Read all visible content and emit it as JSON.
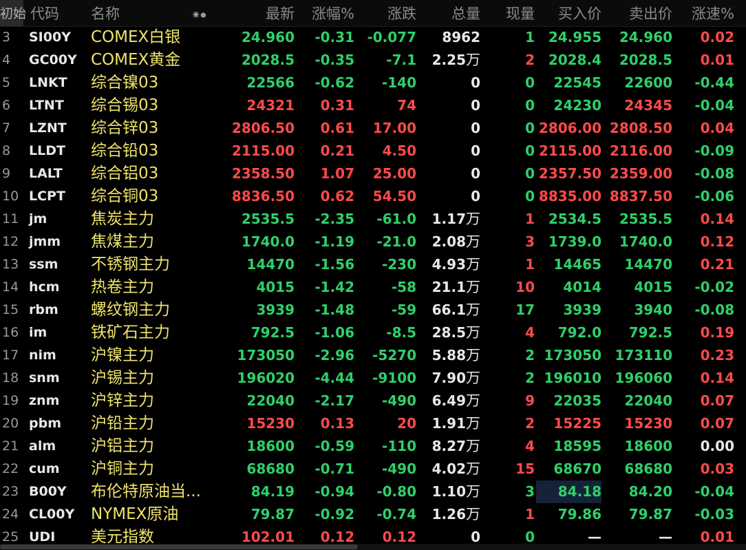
{
  "header": {
    "init": "初始",
    "code": "代码",
    "name": "名称",
    "icons": "✷⏺",
    "last": "最新",
    "pct": "涨幅%",
    "chg": "涨跌",
    "vol": "总量",
    "cur": "现量",
    "bid": "买入价",
    "ask": "卖出价",
    "spd": "涨速%"
  },
  "colors": {
    "up": "#ff4a4a",
    "down": "#2fd06a",
    "flat": "#e8e8e8",
    "name": "#f0e36a",
    "background": "#000000"
  },
  "rows": [
    {
      "idx": "3",
      "code": "SI00Y",
      "name": "COMEX白银",
      "last": "24.960",
      "pct": "-0.31",
      "chg": "-0.077",
      "vol": "8962",
      "vol_unit": "",
      "cur": "1",
      "bid": "24.955",
      "ask": "24.960",
      "spd": "0.02",
      "dir": "dn",
      "cur_dir": "dn",
      "spd_dir": "up",
      "bid_dir": "dn",
      "ask_dir": "dn"
    },
    {
      "idx": "4",
      "code": "GC00Y",
      "name": "COMEX黄金",
      "last": "2028.5",
      "pct": "-0.35",
      "chg": "-7.1",
      "vol": "2.25",
      "vol_unit": "万",
      "cur": "2",
      "bid": "2028.4",
      "ask": "2028.5",
      "spd": "0.01",
      "dir": "dn",
      "cur_dir": "up",
      "spd_dir": "up",
      "bid_dir": "dn",
      "ask_dir": "dn"
    },
    {
      "idx": "5",
      "code": "LNKT",
      "name": "综合镍03",
      "last": "22566",
      "pct": "-0.62",
      "chg": "-140",
      "vol": "0",
      "vol_unit": "",
      "cur": "0",
      "bid": "22545",
      "ask": "22600",
      "spd": "-0.44",
      "dir": "dn",
      "cur_dir": "dn",
      "spd_dir": "dn",
      "bid_dir": "dn",
      "ask_dir": "dn"
    },
    {
      "idx": "6",
      "code": "LTNT",
      "name": "综合锡03",
      "last": "24321",
      "pct": "0.31",
      "chg": "74",
      "vol": "0",
      "vol_unit": "",
      "cur": "0",
      "bid": "24230",
      "ask": "24345",
      "spd": "-0.04",
      "dir": "up",
      "cur_dir": "dn",
      "spd_dir": "dn",
      "bid_dir": "dn",
      "ask_dir": "up"
    },
    {
      "idx": "7",
      "code": "LZNT",
      "name": "综合锌03",
      "last": "2806.50",
      "pct": "0.61",
      "chg": "17.00",
      "vol": "0",
      "vol_unit": "",
      "cur": "0",
      "bid": "2806.00",
      "ask": "2808.50",
      "spd": "0.04",
      "dir": "up",
      "cur_dir": "dn",
      "spd_dir": "up",
      "bid_dir": "up",
      "ask_dir": "up"
    },
    {
      "idx": "8",
      "code": "LLDT",
      "name": "综合铅03",
      "last": "2115.00",
      "pct": "0.21",
      "chg": "4.50",
      "vol": "0",
      "vol_unit": "",
      "cur": "0",
      "bid": "2115.00",
      "ask": "2116.00",
      "spd": "-0.09",
      "dir": "up",
      "cur_dir": "dn",
      "spd_dir": "dn",
      "bid_dir": "up",
      "ask_dir": "up"
    },
    {
      "idx": "9",
      "code": "LALT",
      "name": "综合铝03",
      "last": "2358.50",
      "pct": "1.07",
      "chg": "25.00",
      "vol": "0",
      "vol_unit": "",
      "cur": "0",
      "bid": "2357.50",
      "ask": "2359.00",
      "spd": "-0.08",
      "dir": "up",
      "cur_dir": "dn",
      "spd_dir": "dn",
      "bid_dir": "up",
      "ask_dir": "up"
    },
    {
      "idx": "10",
      "code": "LCPT",
      "name": "综合铜03",
      "last": "8836.50",
      "pct": "0.62",
      "chg": "54.50",
      "vol": "0",
      "vol_unit": "",
      "cur": "0",
      "bid": "8835.00",
      "ask": "8837.50",
      "spd": "-0.06",
      "dir": "up",
      "cur_dir": "dn",
      "spd_dir": "dn",
      "bid_dir": "up",
      "ask_dir": "up"
    },
    {
      "idx": "11",
      "code": "jm",
      "name": "焦炭主力",
      "last": "2535.5",
      "pct": "-2.35",
      "chg": "-61.0",
      "vol": "1.17",
      "vol_unit": "万",
      "cur": "1",
      "bid": "2534.5",
      "ask": "2535.5",
      "spd": "0.14",
      "dir": "dn",
      "cur_dir": "up",
      "spd_dir": "up",
      "bid_dir": "dn",
      "ask_dir": "dn"
    },
    {
      "idx": "12",
      "code": "jmm",
      "name": "焦煤主力",
      "last": "1740.0",
      "pct": "-1.19",
      "chg": "-21.0",
      "vol": "2.08",
      "vol_unit": "万",
      "cur": "3",
      "bid": "1739.0",
      "ask": "1740.0",
      "spd": "0.12",
      "dir": "dn",
      "cur_dir": "up",
      "spd_dir": "up",
      "bid_dir": "dn",
      "ask_dir": "dn"
    },
    {
      "idx": "13",
      "code": "ssm",
      "name": "不锈钢主力",
      "last": "14470",
      "pct": "-1.56",
      "chg": "-230",
      "vol": "4.93",
      "vol_unit": "万",
      "cur": "1",
      "bid": "14465",
      "ask": "14470",
      "spd": "0.21",
      "dir": "dn",
      "cur_dir": "up",
      "spd_dir": "up",
      "bid_dir": "dn",
      "ask_dir": "dn"
    },
    {
      "idx": "14",
      "code": "hcm",
      "name": "热卷主力",
      "last": "4015",
      "pct": "-1.42",
      "chg": "-58",
      "vol": "21.1",
      "vol_unit": "万",
      "cur": "10",
      "bid": "4014",
      "ask": "4015",
      "spd": "-0.02",
      "dir": "dn",
      "cur_dir": "up",
      "spd_dir": "dn",
      "bid_dir": "dn",
      "ask_dir": "dn"
    },
    {
      "idx": "15",
      "code": "rbm",
      "name": "螺纹钢主力",
      "last": "3939",
      "pct": "-1.48",
      "chg": "-59",
      "vol": "66.1",
      "vol_unit": "万",
      "cur": "17",
      "bid": "3939",
      "ask": "3940",
      "spd": "-0.08",
      "dir": "dn",
      "cur_dir": "dn",
      "spd_dir": "dn",
      "bid_dir": "dn",
      "ask_dir": "dn"
    },
    {
      "idx": "16",
      "code": "im",
      "name": "铁矿石主力",
      "last": "792.5",
      "pct": "-1.06",
      "chg": "-8.5",
      "vol": "28.5",
      "vol_unit": "万",
      "cur": "4",
      "bid": "792.0",
      "ask": "792.5",
      "spd": "0.19",
      "dir": "dn",
      "cur_dir": "up",
      "spd_dir": "up",
      "bid_dir": "dn",
      "ask_dir": "dn"
    },
    {
      "idx": "17",
      "code": "nim",
      "name": "沪镍主力",
      "last": "173050",
      "pct": "-2.96",
      "chg": "-5270",
      "vol": "5.88",
      "vol_unit": "万",
      "cur": "2",
      "bid": "173050",
      "ask": "173110",
      "spd": "0.23",
      "dir": "dn",
      "cur_dir": "dn",
      "spd_dir": "up",
      "bid_dir": "dn",
      "ask_dir": "dn"
    },
    {
      "idx": "18",
      "code": "snm",
      "name": "沪锡主力",
      "last": "196020",
      "pct": "-4.44",
      "chg": "-9100",
      "vol": "7.90",
      "vol_unit": "万",
      "cur": "2",
      "bid": "196010",
      "ask": "196060",
      "spd": "0.14",
      "dir": "dn",
      "cur_dir": "dn",
      "spd_dir": "up",
      "bid_dir": "dn",
      "ask_dir": "dn"
    },
    {
      "idx": "19",
      "code": "znm",
      "name": "沪锌主力",
      "last": "22040",
      "pct": "-2.17",
      "chg": "-490",
      "vol": "6.49",
      "vol_unit": "万",
      "cur": "9",
      "bid": "22035",
      "ask": "22040",
      "spd": "0.07",
      "dir": "dn",
      "cur_dir": "up",
      "spd_dir": "up",
      "bid_dir": "dn",
      "ask_dir": "dn"
    },
    {
      "idx": "20",
      "code": "pbm",
      "name": "沪铅主力",
      "last": "15230",
      "pct": "0.13",
      "chg": "20",
      "vol": "1.91",
      "vol_unit": "万",
      "cur": "2",
      "bid": "15225",
      "ask": "15230",
      "spd": "0.07",
      "dir": "up",
      "cur_dir": "up",
      "spd_dir": "up",
      "bid_dir": "up",
      "ask_dir": "up"
    },
    {
      "idx": "21",
      "code": "alm",
      "name": "沪铝主力",
      "last": "18600",
      "pct": "-0.59",
      "chg": "-110",
      "vol": "8.27",
      "vol_unit": "万",
      "cur": "4",
      "bid": "18595",
      "ask": "18600",
      "spd": "0.00",
      "dir": "dn",
      "cur_dir": "up",
      "spd_dir": "fl",
      "bid_dir": "dn",
      "ask_dir": "dn"
    },
    {
      "idx": "22",
      "code": "cum",
      "name": "沪铜主力",
      "last": "68680",
      "pct": "-0.71",
      "chg": "-490",
      "vol": "4.02",
      "vol_unit": "万",
      "cur": "15",
      "bid": "68670",
      "ask": "68680",
      "spd": "0.03",
      "dir": "dn",
      "cur_dir": "up",
      "spd_dir": "up",
      "bid_dir": "dn",
      "ask_dir": "dn"
    },
    {
      "idx": "23",
      "code": "B00Y",
      "name": "布伦特原油当...",
      "last": "84.19",
      "pct": "-0.94",
      "chg": "-0.80",
      "vol": "1.10",
      "vol_unit": "万",
      "cur": "3",
      "bid": "84.18",
      "ask": "84.20",
      "spd": "-0.04",
      "dir": "dn",
      "cur_dir": "dn",
      "spd_dir": "dn",
      "bid_dir": "dn",
      "ask_dir": "dn",
      "highlight_bid": true
    },
    {
      "idx": "24",
      "code": "CL00Y",
      "name": "NYMEX原油",
      "last": "79.87",
      "pct": "-0.92",
      "chg": "-0.74",
      "vol": "1.26",
      "vol_unit": "万",
      "cur": "1",
      "bid": "79.86",
      "ask": "79.87",
      "spd": "-0.03",
      "dir": "dn",
      "cur_dir": "up",
      "spd_dir": "dn",
      "bid_dir": "dn",
      "ask_dir": "dn"
    },
    {
      "idx": "25",
      "code": "UDI",
      "name": "美元指数",
      "last": "102.01",
      "pct": "0.12",
      "chg": "0.12",
      "vol": "0",
      "vol_unit": "",
      "cur": "0",
      "bid": "—",
      "ask": "—",
      "spd": "0.01",
      "dir": "up",
      "cur_dir": "dn",
      "spd_dir": "up",
      "bid_dir": "fl",
      "ask_dir": "fl"
    }
  ]
}
